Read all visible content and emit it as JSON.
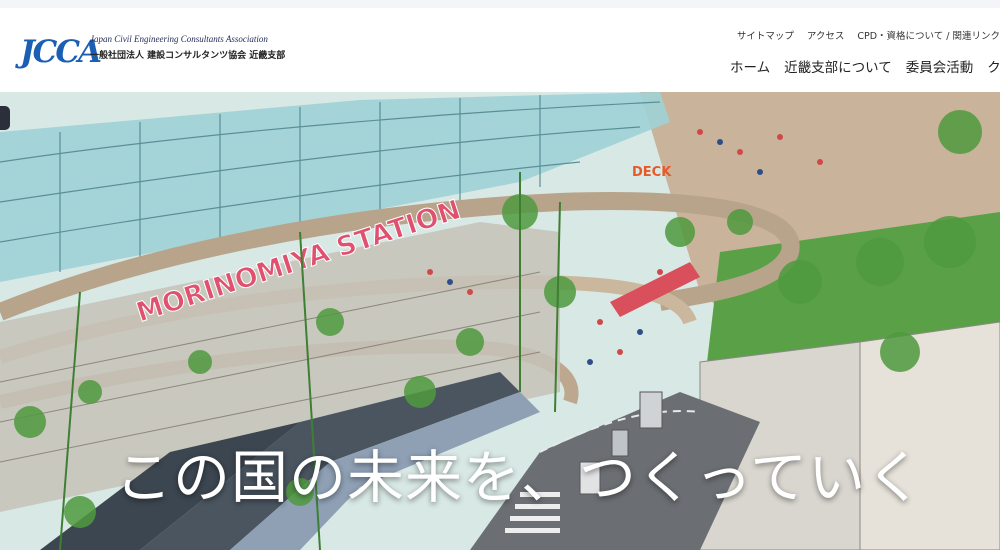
{
  "header": {
    "logo": {
      "mark": "JCCA",
      "org_en": "Japan Civil Engineering Consultants Association",
      "org_ja": "一般社団法人 建設コンサルタンツ協会 近畿支部"
    },
    "utility_nav": [
      "サイトマップ",
      "アクセス",
      "CPD・資格について / 関連リンク"
    ],
    "main_nav": [
      "ホーム",
      "近畿支部について",
      "委員会活動",
      "クリ"
    ]
  },
  "hero": {
    "tagline": "この国の未来を、つくっていく",
    "illustration_signs": [
      "MORINOMIYA STATION",
      "DECK"
    ]
  },
  "colors": {
    "brand_blue": "#1a5fb4",
    "sign_pink": "#e0506f",
    "foliage_green": "#4f9a3e",
    "glass_teal": "#8cc9cf"
  }
}
